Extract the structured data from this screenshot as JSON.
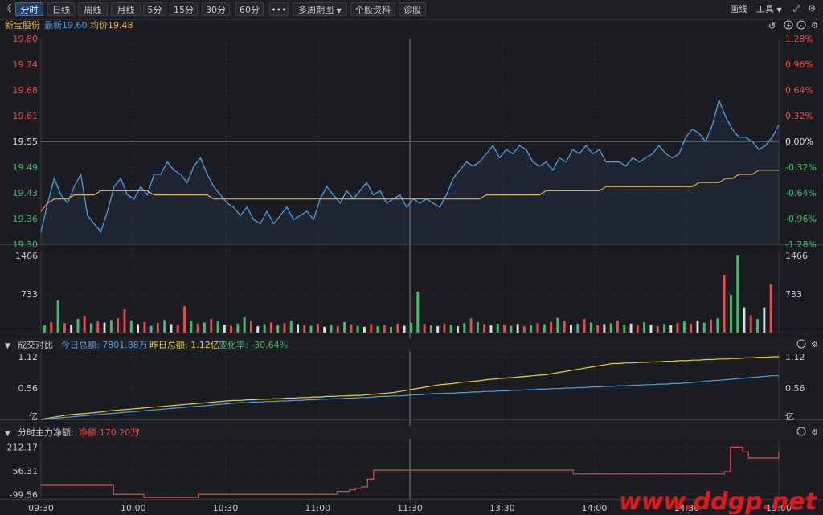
{
  "toolbar": {
    "back_glyph": "《",
    "tabs": [
      "分时",
      "日线",
      "周线",
      "月线",
      "5分",
      "15分",
      "30分",
      "60分"
    ],
    "more_label": "•••",
    "multi_period_label": "多周期图",
    "stock_info_label": "个股资料",
    "diagnose_label": "诊股",
    "draw_label": "画线",
    "tools_label": "工具"
  },
  "info": {
    "stock_name": "新宝股份",
    "latest_label": "最新19.60",
    "avg_label": "均价19.48"
  },
  "panel_turnover": {
    "title": "成交对比",
    "today_label": "今日总额: 7801.88万",
    "yesterday_label": "昨日总额: 1.12亿",
    "change_label": "变化率: -30.64%"
  },
  "panel_flow": {
    "title": "分时主力净额:",
    "net_label": "净额:170.20万"
  },
  "watermark": "www.ddgp.net",
  "colors": {
    "price_line": "#4a9fe5",
    "avg_line": "#e8b04b",
    "up": "#f04848",
    "down": "#3fbf6a",
    "neutral": "#dcdcdc",
    "yesterday_line": "#e8d028",
    "flow_line": "#e04848"
  },
  "chart_data": {
    "type": "line",
    "x_ticks": [
      "09:30",
      "10:00",
      "10:30",
      "11:00",
      "11:30",
      "13:30",
      "14:00",
      "14:30",
      "15:00"
    ],
    "price": {
      "ylim": [
        19.3,
        19.8
      ],
      "y_ticks": [
        "19.80",
        "19.74",
        "19.68",
        "19.61",
        "19.55",
        "19.49",
        "19.43",
        "19.36",
        "19.30"
      ],
      "pct_ticks": [
        "1.28%",
        "0.96%",
        "0.64%",
        "0.32%",
        "0.00%",
        "-0.32%",
        "-0.64%",
        "-0.96%",
        "-1.28%"
      ],
      "series": [
        {
          "values": [
            19.33,
            19.4,
            19.46,
            19.42,
            19.4,
            19.44,
            19.47,
            19.37,
            19.35,
            19.33,
            19.38,
            19.44,
            19.46,
            19.42,
            19.41,
            19.44,
            19.42,
            19.47,
            19.47,
            19.5,
            19.48,
            19.47,
            19.45,
            19.49,
            19.51,
            19.47,
            19.44,
            19.42,
            19.4,
            19.39,
            19.37,
            19.39,
            19.36,
            19.35,
            19.38,
            19.35,
            19.37,
            19.39,
            19.36,
            19.37,
            19.38,
            19.36,
            19.41,
            19.44,
            19.42,
            19.4,
            19.43,
            19.41,
            19.43,
            19.45,
            19.42,
            19.43,
            19.4,
            19.41,
            19.42,
            19.39,
            19.41,
            19.4,
            19.41,
            19.4,
            19.39,
            19.42,
            19.46,
            19.48,
            19.5,
            19.49,
            19.5,
            19.52,
            19.54,
            19.51,
            19.53,
            19.52,
            19.54,
            19.53,
            19.5,
            19.49,
            19.5,
            19.48,
            19.51,
            19.5,
            19.53,
            19.52,
            19.54,
            19.52,
            19.53,
            19.5,
            19.5,
            19.5,
            19.49,
            19.51,
            19.5,
            19.51,
            19.52,
            19.54,
            19.52,
            19.51,
            19.52,
            19.56,
            19.58,
            19.57,
            19.55,
            19.59,
            19.65,
            19.61,
            19.58,
            19.56,
            19.56,
            19.55,
            19.53,
            19.54,
            19.56,
            19.59
          ],
          "name": ""
        },
        {
          "values": [
            19.38,
            19.4,
            19.41,
            19.41,
            19.41,
            19.42,
            19.42,
            19.42,
            19.42,
            19.43,
            19.43,
            19.43,
            19.43,
            19.43,
            19.43,
            19.43,
            19.43,
            19.42,
            19.42,
            19.42,
            19.42,
            19.42,
            19.42,
            19.42,
            19.42,
            19.42,
            19.41,
            19.41,
            19.41,
            19.41,
            19.41,
            19.41,
            19.41,
            19.41,
            19.41,
            19.41,
            19.41,
            19.41,
            19.41,
            19.41,
            19.41,
            19.41,
            19.41,
            19.41,
            19.41,
            19.41,
            19.41,
            19.41,
            19.41,
            19.41,
            19.41,
            19.41,
            19.41,
            19.41,
            19.41,
            19.41,
            19.41,
            19.41,
            19.41,
            19.41,
            19.41,
            19.41,
            19.41,
            19.41,
            19.41,
            19.41,
            19.41,
            19.42,
            19.42,
            19.42,
            19.42,
            19.42,
            19.42,
            19.42,
            19.42,
            19.42,
            19.43,
            19.43,
            19.43,
            19.43,
            19.43,
            19.43,
            19.43,
            19.43,
            19.43,
            19.44,
            19.44,
            19.44,
            19.44,
            19.44,
            19.44,
            19.44,
            19.44,
            19.44,
            19.44,
            19.44,
            19.44,
            19.44,
            19.44,
            19.45,
            19.45,
            19.45,
            19.45,
            19.46,
            19.46,
            19.47,
            19.47,
            19.47,
            19.48,
            19.48,
            19.48,
            19.48
          ],
          "name": ""
        }
      ]
    },
    "volume": {
      "ylim": [
        0,
        1466
      ],
      "y_ticks": [
        "1466",
        "733"
      ],
      "bars": [
        {
          "v": 140,
          "d": "d"
        },
        {
          "v": 200,
          "d": "u"
        },
        {
          "v": 610,
          "d": "d"
        },
        {
          "v": 180,
          "d": "u"
        },
        {
          "v": 150,
          "d": "n"
        },
        {
          "v": 260,
          "d": "d"
        },
        {
          "v": 320,
          "d": "u"
        },
        {
          "v": 180,
          "d": "d"
        },
        {
          "v": 210,
          "d": "u"
        },
        {
          "v": 190,
          "d": "n"
        },
        {
          "v": 240,
          "d": "d"
        },
        {
          "v": 270,
          "d": "u"
        },
        {
          "v": 450,
          "d": "u"
        },
        {
          "v": 230,
          "d": "d"
        },
        {
          "v": 160,
          "d": "n"
        },
        {
          "v": 200,
          "d": "u"
        },
        {
          "v": 130,
          "d": "d"
        },
        {
          "v": 180,
          "d": "u"
        },
        {
          "v": 240,
          "d": "d"
        },
        {
          "v": 160,
          "d": "n"
        },
        {
          "v": 150,
          "d": "u"
        },
        {
          "v": 500,
          "d": "u"
        },
        {
          "v": 220,
          "d": "d"
        },
        {
          "v": 170,
          "d": "u"
        },
        {
          "v": 190,
          "d": "d"
        },
        {
          "v": 260,
          "d": "u"
        },
        {
          "v": 210,
          "d": "d"
        },
        {
          "v": 150,
          "d": "n"
        },
        {
          "v": 130,
          "d": "u"
        },
        {
          "v": 170,
          "d": "d"
        },
        {
          "v": 300,
          "d": "d"
        },
        {
          "v": 210,
          "d": "u"
        },
        {
          "v": 120,
          "d": "n"
        },
        {
          "v": 160,
          "d": "d"
        },
        {
          "v": 190,
          "d": "u"
        },
        {
          "v": 140,
          "d": "d"
        },
        {
          "v": 180,
          "d": "u"
        },
        {
          "v": 220,
          "d": "d"
        },
        {
          "v": 160,
          "d": "n"
        },
        {
          "v": 140,
          "d": "u"
        },
        {
          "v": 130,
          "d": "d"
        },
        {
          "v": 170,
          "d": "u"
        },
        {
          "v": 110,
          "d": "n"
        },
        {
          "v": 150,
          "d": "d"
        },
        {
          "v": 120,
          "d": "u"
        },
        {
          "v": 200,
          "d": "d"
        },
        {
          "v": 160,
          "d": "u"
        },
        {
          "v": 130,
          "d": "d"
        },
        {
          "v": 110,
          "d": "n"
        },
        {
          "v": 160,
          "d": "u"
        },
        {
          "v": 120,
          "d": "d"
        },
        {
          "v": 140,
          "d": "u"
        },
        {
          "v": 110,
          "d": "d"
        },
        {
          "v": 170,
          "d": "u"
        },
        {
          "v": 130,
          "d": "n"
        },
        {
          "v": 190,
          "d": "d"
        },
        {
          "v": 780,
          "d": "d"
        },
        {
          "v": 160,
          "d": "u"
        },
        {
          "v": 140,
          "d": "d"
        },
        {
          "v": 120,
          "d": "n"
        },
        {
          "v": 170,
          "d": "u"
        },
        {
          "v": 150,
          "d": "d"
        },
        {
          "v": 120,
          "d": "n"
        },
        {
          "v": 180,
          "d": "d"
        },
        {
          "v": 270,
          "d": "u"
        },
        {
          "v": 200,
          "d": "d"
        },
        {
          "v": 160,
          "d": "u"
        },
        {
          "v": 140,
          "d": "n"
        },
        {
          "v": 170,
          "d": "d"
        },
        {
          "v": 150,
          "d": "u"
        },
        {
          "v": 130,
          "d": "d"
        },
        {
          "v": 160,
          "d": "n"
        },
        {
          "v": 120,
          "d": "u"
        },
        {
          "v": 140,
          "d": "d"
        },
        {
          "v": 180,
          "d": "u"
        },
        {
          "v": 160,
          "d": "d"
        },
        {
          "v": 200,
          "d": "u"
        },
        {
          "v": 280,
          "d": "d"
        },
        {
          "v": 220,
          "d": "u"
        },
        {
          "v": 150,
          "d": "n"
        },
        {
          "v": 170,
          "d": "d"
        },
        {
          "v": 260,
          "d": "u"
        },
        {
          "v": 190,
          "d": "d"
        },
        {
          "v": 140,
          "d": "u"
        },
        {
          "v": 160,
          "d": "n"
        },
        {
          "v": 180,
          "d": "d"
        },
        {
          "v": 230,
          "d": "u"
        },
        {
          "v": 150,
          "d": "d"
        },
        {
          "v": 170,
          "d": "n"
        },
        {
          "v": 140,
          "d": "u"
        },
        {
          "v": 200,
          "d": "d"
        },
        {
          "v": 150,
          "d": "n"
        },
        {
          "v": 120,
          "d": "u"
        },
        {
          "v": 160,
          "d": "d"
        },
        {
          "v": 140,
          "d": "n"
        },
        {
          "v": 180,
          "d": "u"
        },
        {
          "v": 210,
          "d": "d"
        },
        {
          "v": 170,
          "d": "u"
        },
        {
          "v": 230,
          "d": "n"
        },
        {
          "v": 190,
          "d": "d"
        },
        {
          "v": 250,
          "d": "u"
        },
        {
          "v": 270,
          "d": "d"
        },
        {
          "v": 1100,
          "d": "u"
        },
        {
          "v": 720,
          "d": "d"
        },
        {
          "v": 1466,
          "d": "d"
        },
        {
          "v": 480,
          "d": "n"
        },
        {
          "v": 330,
          "d": "u"
        },
        {
          "v": 260,
          "d": "d"
        },
        {
          "v": 480,
          "d": "n"
        },
        {
          "v": 920,
          "d": "u"
        }
      ]
    },
    "turnover": {
      "ylim": [
        0,
        1.12
      ],
      "y_ticks": [
        "1.12",
        "0.56",
        "亿"
      ],
      "series": [
        {
          "values": [
            0.0,
            0.02,
            0.04,
            0.06,
            0.08,
            0.09,
            0.1,
            0.11,
            0.12,
            0.13,
            0.15,
            0.16,
            0.17,
            0.18,
            0.19,
            0.2,
            0.21,
            0.22,
            0.23,
            0.24,
            0.25,
            0.26,
            0.27,
            0.28,
            0.29,
            0.3,
            0.31,
            0.32,
            0.33,
            0.34,
            0.34,
            0.35,
            0.35,
            0.36,
            0.36,
            0.37,
            0.37,
            0.38,
            0.38,
            0.39,
            0.39,
            0.4,
            0.4,
            0.41,
            0.41,
            0.42,
            0.42,
            0.43,
            0.43,
            0.44,
            0.45,
            0.46,
            0.47,
            0.48,
            0.5,
            0.52,
            0.54,
            0.56,
            0.58,
            0.6,
            0.62,
            0.63,
            0.64,
            0.66,
            0.67,
            0.68,
            0.69,
            0.71,
            0.72,
            0.73,
            0.74,
            0.75,
            0.76,
            0.77,
            0.78,
            0.79,
            0.8,
            0.82,
            0.84,
            0.86,
            0.88,
            0.9,
            0.92,
            0.94,
            0.96,
            0.98,
            1.0,
            1.0,
            1.01,
            1.01,
            1.02,
            1.02,
            1.03,
            1.03,
            1.04,
            1.04,
            1.05,
            1.05,
            1.06,
            1.06,
            1.07,
            1.07,
            1.08,
            1.08,
            1.09,
            1.09,
            1.1,
            1.1,
            1.11,
            1.11,
            1.12,
            1.12
          ],
          "name": ""
        },
        {
          "values": [
            0.0,
            0.01,
            0.02,
            0.03,
            0.04,
            0.05,
            0.06,
            0.07,
            0.08,
            0.09,
            0.1,
            0.11,
            0.12,
            0.13,
            0.14,
            0.15,
            0.16,
            0.17,
            0.18,
            0.19,
            0.2,
            0.21,
            0.22,
            0.23,
            0.24,
            0.25,
            0.26,
            0.27,
            0.28,
            0.29,
            0.3,
            0.3,
            0.31,
            0.31,
            0.32,
            0.32,
            0.33,
            0.33,
            0.34,
            0.34,
            0.35,
            0.35,
            0.36,
            0.36,
            0.37,
            0.37,
            0.38,
            0.38,
            0.39,
            0.39,
            0.4,
            0.41,
            0.41,
            0.42,
            0.42,
            0.43,
            0.44,
            0.44,
            0.45,
            0.46,
            0.46,
            0.47,
            0.47,
            0.48,
            0.48,
            0.49,
            0.49,
            0.5,
            0.5,
            0.51,
            0.51,
            0.52,
            0.52,
            0.53,
            0.53,
            0.54,
            0.54,
            0.55,
            0.55,
            0.56,
            0.56,
            0.57,
            0.57,
            0.58,
            0.58,
            0.59,
            0.59,
            0.6,
            0.6,
            0.61,
            0.61,
            0.62,
            0.62,
            0.63,
            0.63,
            0.64,
            0.64,
            0.65,
            0.66,
            0.67,
            0.68,
            0.69,
            0.7,
            0.71,
            0.72,
            0.73,
            0.74,
            0.75,
            0.76,
            0.77,
            0.78,
            0.78
          ],
          "name": ""
        }
      ]
    },
    "flow": {
      "ylim": [
        -130,
        230
      ],
      "y_ticks": [
        "212.17",
        "56.31",
        "-99.56"
      ],
      "values": [
        -40,
        -40,
        -40,
        -40,
        -40,
        -40,
        -40,
        -40,
        -40,
        -40,
        -40,
        -40,
        -99,
        -99,
        -99,
        -99,
        -99,
        -120,
        -120,
        -120,
        -120,
        -120,
        -120,
        -120,
        -120,
        -120,
        -99,
        -99,
        -99,
        -99,
        -99,
        -99,
        -99,
        -99,
        -99,
        -99,
        -99,
        -99,
        -99,
        -99,
        -99,
        -99,
        -99,
        -99,
        -99,
        -99,
        -99,
        -99,
        -99,
        -80,
        -80,
        -70,
        -60,
        -50,
        0,
        60,
        60,
        60,
        60,
        60,
        60,
        60,
        60,
        60,
        60,
        60,
        60,
        60,
        60,
        60,
        60,
        60,
        60,
        60,
        60,
        60,
        60,
        60,
        60,
        60,
        60,
        60,
        60,
        60,
        60,
        60,
        60,
        60,
        35,
        35,
        35,
        35,
        35,
        35,
        35,
        35,
        35,
        35,
        35,
        35,
        35,
        35,
        35,
        35,
        35,
        35,
        35,
        35,
        35,
        35,
        35,
        35,
        35,
        50,
        212,
        212,
        180,
        140,
        140,
        140,
        140,
        140,
        180
      ]
    }
  }
}
